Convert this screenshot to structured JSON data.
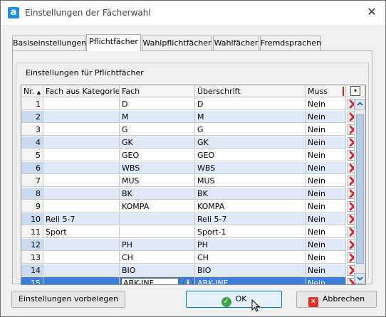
{
  "window": {
    "title": "Einstellungen der Fächerwahl",
    "app_icon_letter": "a"
  },
  "tabs": [
    {
      "label": "Basiseinstellungen"
    },
    {
      "label": "Pflichtfächer"
    },
    {
      "label": "Wahlpflichtfächer"
    },
    {
      "label": "Wahlfächer"
    },
    {
      "label": "Fremdsprachen"
    }
  ],
  "active_tab": "Pflichtfächer",
  "group": {
    "title": "Einstellungen für Pflichtfächer"
  },
  "table": {
    "columns": [
      "Nr.",
      "Fach aus Kategorie",
      "Fach",
      "Überschrift",
      "Muss"
    ],
    "sort_indicator": "ascending",
    "rows": [
      {
        "nr": "1",
        "kategorie": "",
        "fach": "D",
        "ueberschrift": "D",
        "muss": "Nein"
      },
      {
        "nr": "2",
        "kategorie": "",
        "fach": "M",
        "ueberschrift": "M",
        "muss": "Nein"
      },
      {
        "nr": "3",
        "kategorie": "",
        "fach": "G",
        "ueberschrift": "G",
        "muss": "Nein"
      },
      {
        "nr": "4",
        "kategorie": "",
        "fach": "GK",
        "ueberschrift": "GK",
        "muss": "Nein"
      },
      {
        "nr": "5",
        "kategorie": "",
        "fach": "GEO",
        "ueberschrift": "GEO",
        "muss": "Nein"
      },
      {
        "nr": "6",
        "kategorie": "",
        "fach": "WBS",
        "ueberschrift": "WBS",
        "muss": "Nein"
      },
      {
        "nr": "7",
        "kategorie": "",
        "fach": "MUS",
        "ueberschrift": "MUS",
        "muss": "Nein"
      },
      {
        "nr": "8",
        "kategorie": "",
        "fach": "BK",
        "ueberschrift": "BK",
        "muss": "Nein"
      },
      {
        "nr": "9",
        "kategorie": "",
        "fach": "KOMPA",
        "ueberschrift": "KOMPA",
        "muss": "Nein"
      },
      {
        "nr": "10",
        "kategorie": "Reli 5-7",
        "fach": "",
        "ueberschrift": "Reli 5-7",
        "muss": "Nein"
      },
      {
        "nr": "11",
        "kategorie": "Sport",
        "fach": "",
        "ueberschrift": "Sport-1",
        "muss": "Nein"
      },
      {
        "nr": "12",
        "kategorie": "",
        "fach": "PH",
        "ueberschrift": "PH",
        "muss": "Nein"
      },
      {
        "nr": "13",
        "kategorie": "",
        "fach": "CH",
        "ueberschrift": "CH",
        "muss": "Nein"
      },
      {
        "nr": "14",
        "kategorie": "",
        "fach": "BIO",
        "ueberschrift": "BIO",
        "muss": "Nein"
      },
      {
        "nr": "15",
        "kategorie": "",
        "fach": "ABK-INF",
        "ueberschrift": "ABK-INF",
        "muss": "Nein"
      }
    ],
    "selected_row": "15",
    "editing_value": "ABK-INF"
  },
  "buttons": {
    "preset": "Einstellungen vorbelegen",
    "ok": "OK",
    "cancel": "Abbrechen"
  },
  "colors": {
    "selection": "#3d7ddc",
    "alt_row": "#dfe9f7",
    "delete_red": "#d9232e",
    "ok_green": "#3aa34a",
    "cancel_red": "#d8322b"
  },
  "icons": {
    "delete": "red-x-icon",
    "info": "info-icon",
    "column_chooser": "column-chooser-icon",
    "scroll_up": "chevron-up-icon",
    "scroll_down": "chevron-down-icon"
  }
}
